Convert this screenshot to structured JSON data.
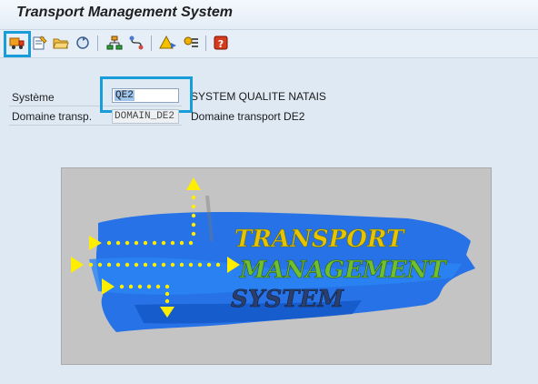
{
  "window": {
    "title": "Transport Management System"
  },
  "toolbar": {
    "buttons": [
      {
        "icon": "truck-transport-icon",
        "label": ""
      },
      {
        "icon": "display-change-icon",
        "label": ""
      },
      {
        "icon": "folder-open-icon",
        "label": ""
      },
      {
        "icon": "refresh-icon",
        "label": ""
      },
      {
        "icon": "hierarchy-icon",
        "label": ""
      },
      {
        "icon": "routes-icon",
        "label": ""
      },
      {
        "icon": "alert-monitor-icon",
        "label": ""
      },
      {
        "icon": "settings-list-icon",
        "label": ""
      },
      {
        "icon": "help-icon",
        "label": ""
      }
    ]
  },
  "form": {
    "system_label": "Système",
    "system_value": "QE2",
    "system_desc": "SYSTEM QUALITE NATAIS",
    "domain_label": "Domaine transp.",
    "domain_value": "DOMAIN_DE2",
    "domain_desc": "Domaine transport DE2"
  },
  "logo": {
    "text_line1": "TRANSPORT",
    "text_line2": "MANAGEMENT",
    "text_line3": "SYSTEM"
  },
  "colors": {
    "highlight": "#199dd8",
    "logo_blue": "#1e6ee8",
    "logo_yellow": "#ffee00"
  }
}
